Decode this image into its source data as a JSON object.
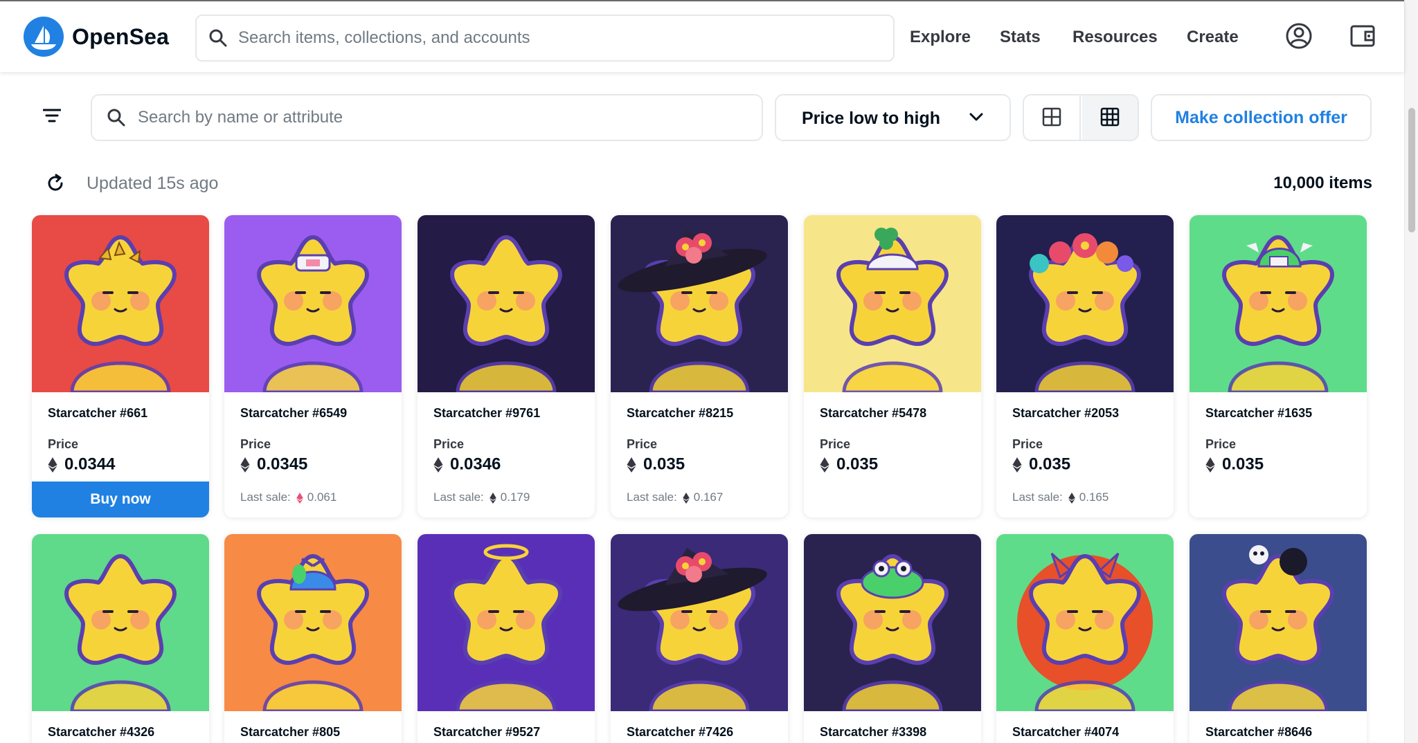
{
  "header": {
    "brand": "OpenSea",
    "search_placeholder": "Search items, collections, and accounts",
    "nav": [
      "Explore",
      "Stats",
      "Resources",
      "Create"
    ]
  },
  "toolbar": {
    "attr_search_placeholder": "Search by name or attribute",
    "sort_label": "Price low to high",
    "offer_label": "Make collection offer",
    "updated": "Updated 15s ago",
    "item_count": "10,000 items"
  },
  "colors": {
    "accent": "#2081e2",
    "text": "#04111d",
    "muted": "#707a83",
    "border": "#e5e8eb"
  },
  "cards": [
    {
      "name": "Starcatcher #661",
      "price_label": "Price",
      "price": "0.0344",
      "last_sale_label": "",
      "last_sale": "",
      "buy_label": "Buy now",
      "bg": "#e84b45",
      "hat": "laurel"
    },
    {
      "name": "Starcatcher #6549",
      "price_label": "Price",
      "price": "0.0345",
      "last_sale_label": "Last sale:",
      "last_sale": "0.061",
      "last_sale_currency": "weth",
      "bg": "#9b5cf0",
      "hat": "headband"
    },
    {
      "name": "Starcatcher #9761",
      "price_label": "Price",
      "price": "0.0346",
      "last_sale_label": "Last sale:",
      "last_sale": "0.179",
      "last_sale_currency": "eth",
      "bg": "#241b46",
      "hat": "none"
    },
    {
      "name": "Starcatcher #8215",
      "price_label": "Price",
      "price": "0.035",
      "last_sale_label": "Last sale:",
      "last_sale": "0.167",
      "last_sale_currency": "eth",
      "bg": "#2a2350",
      "hat": "witch"
    },
    {
      "name": "Starcatcher #5478",
      "price_label": "Price",
      "price": "0.035",
      "last_sale_label": "",
      "last_sale": "",
      "bg": "#f7e58a",
      "hat": "clover"
    },
    {
      "name": "Starcatcher #2053",
      "price_label": "Price",
      "price": "0.035",
      "last_sale_label": "Last sale:",
      "last_sale": "0.165",
      "last_sale_currency": "eth",
      "bg": "#232050",
      "hat": "flowers"
    },
    {
      "name": "Starcatcher #1635",
      "price_label": "Price",
      "price": "0.035",
      "last_sale_label": "",
      "last_sale": "",
      "bg": "#5fdc8a",
      "hat": "cap"
    },
    {
      "name": "Starcatcher #4326",
      "bg": "#5fd98a",
      "hat": "none"
    },
    {
      "name": "Starcatcher #805",
      "bg": "#f78a45",
      "hat": "propeller"
    },
    {
      "name": "Starcatcher #9527",
      "bg": "#5a2fb8",
      "hat": "halo"
    },
    {
      "name": "Starcatcher #7426",
      "bg": "#3a2a78",
      "hat": "witch"
    },
    {
      "name": "Starcatcher #3398",
      "bg": "#2a2350",
      "hat": "frog"
    },
    {
      "name": "Starcatcher #4074",
      "bg": "#5fdc8a",
      "hat": "horns"
    },
    {
      "name": "Starcatcher #8646",
      "bg": "#3b4d8c",
      "hat": "skull"
    }
  ]
}
